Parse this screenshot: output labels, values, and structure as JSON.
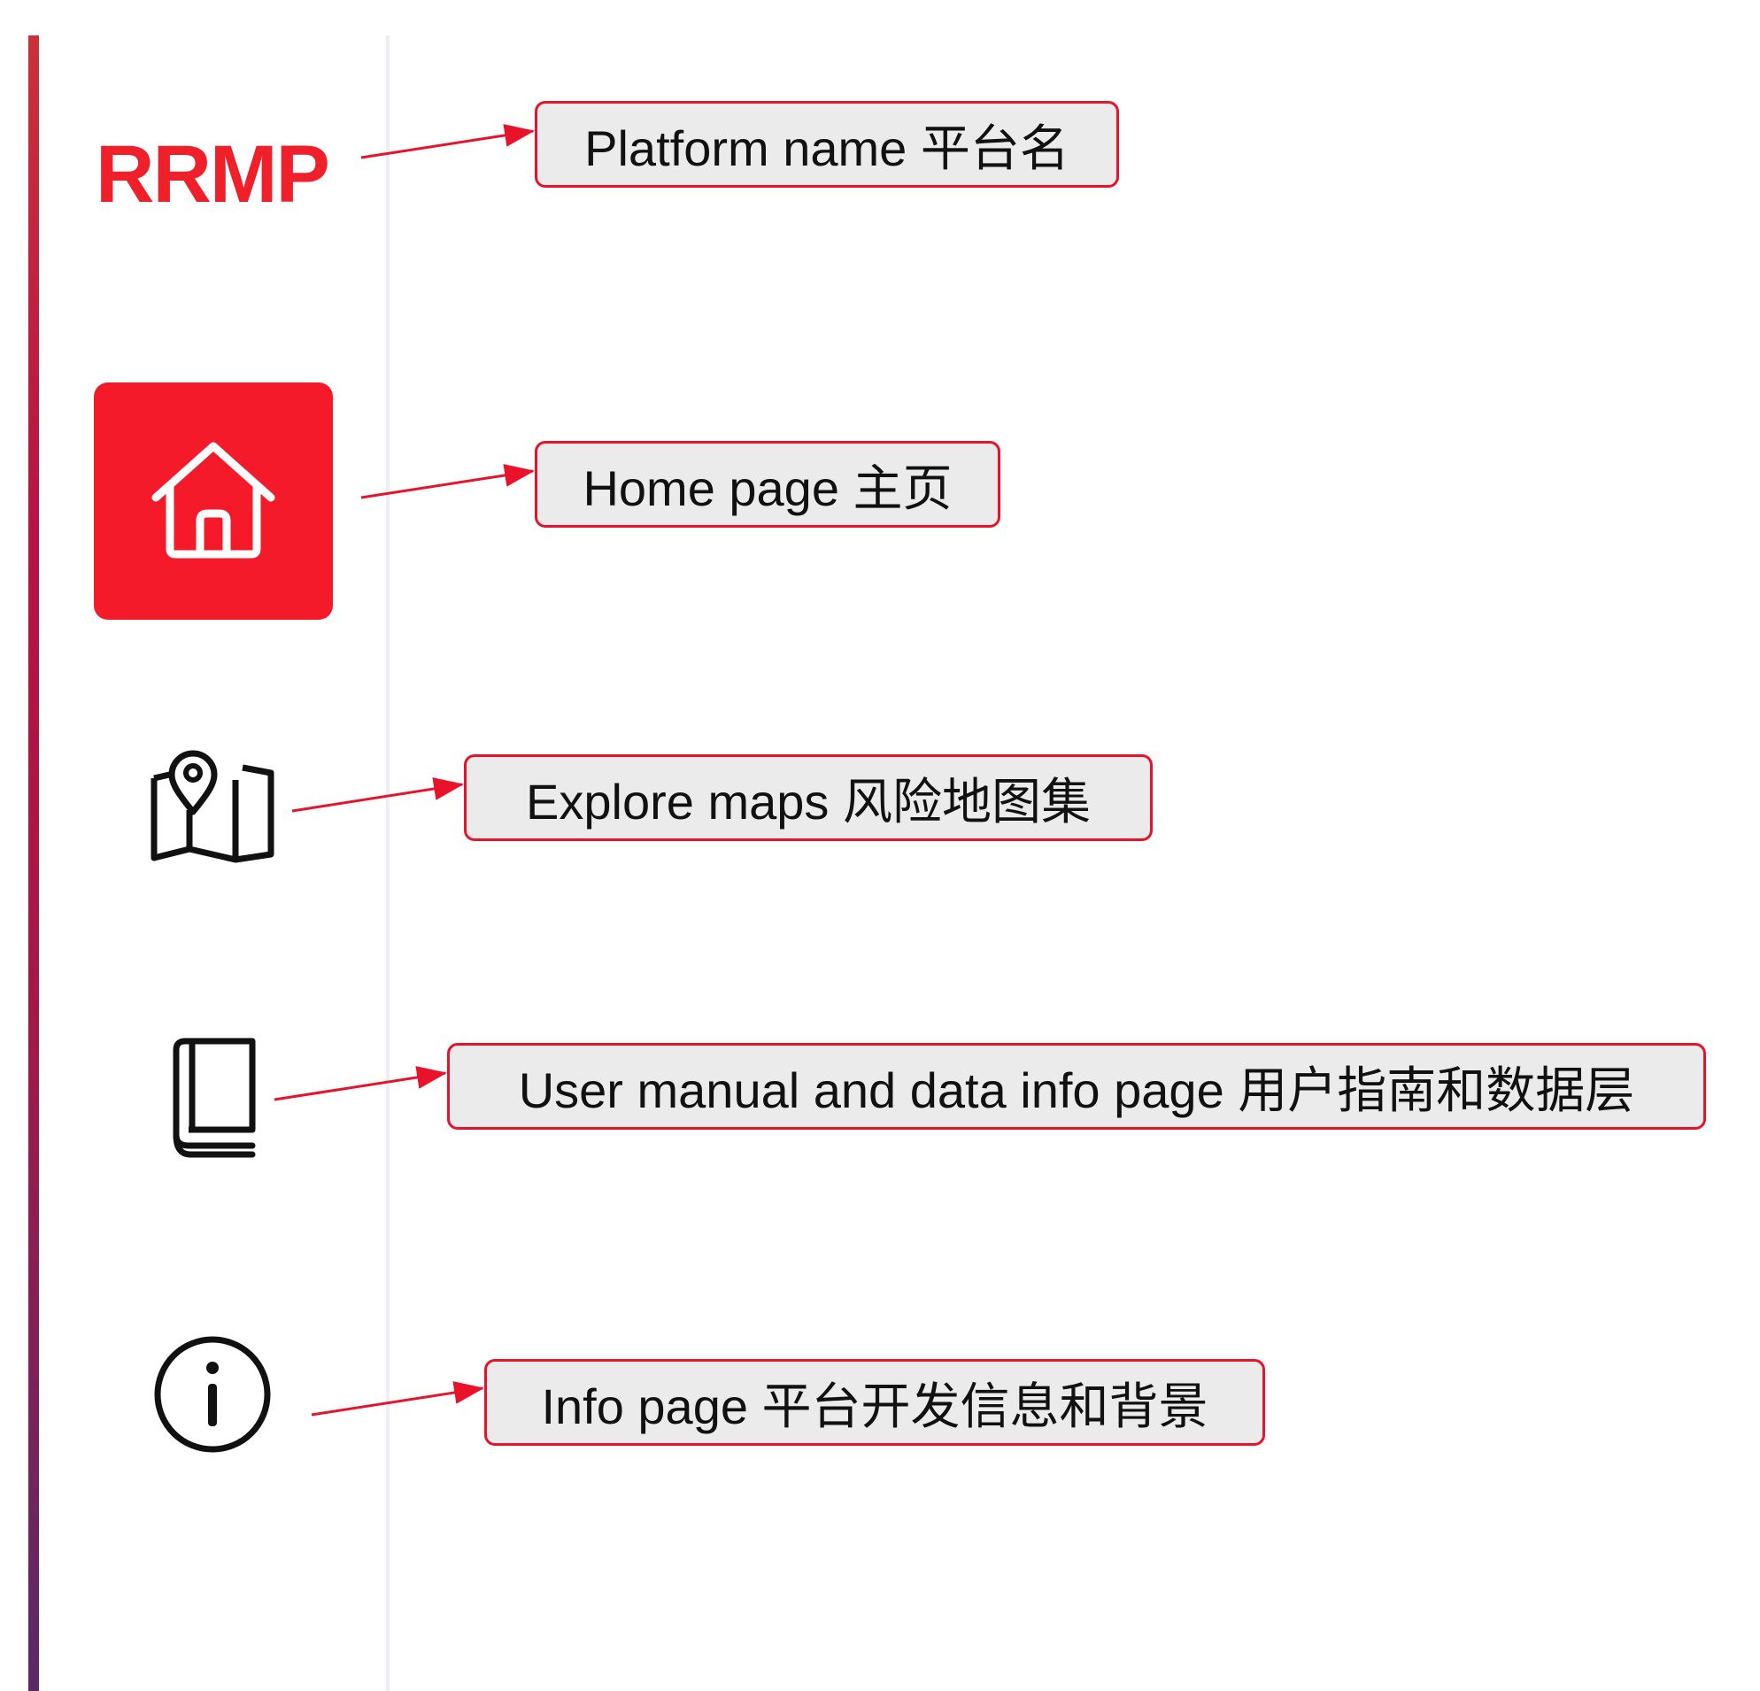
{
  "logo": {
    "text": "RRMP",
    "color": "#f0202a"
  },
  "nav": {
    "items": [
      {
        "id": "home",
        "icon": "home-icon",
        "active": true
      },
      {
        "id": "maps",
        "icon": "map-pin-icon",
        "active": false
      },
      {
        "id": "manual",
        "icon": "book-icon",
        "active": false
      },
      {
        "id": "info",
        "icon": "info-icon",
        "active": false
      }
    ],
    "active_color": "#f41a2a"
  },
  "annotations": [
    {
      "label": "Platform name 平台名"
    },
    {
      "label": "Home page 主页"
    },
    {
      "label": "Explore maps 风险地图集"
    },
    {
      "label": "User manual and data info page 用户指南和数据层"
    },
    {
      "label": "Info page 平台开发信息和背景"
    }
  ],
  "colors": {
    "annotation_border": "#e8122a",
    "annotation_fill": "#ebebeb",
    "arrow": "#e8122a"
  }
}
